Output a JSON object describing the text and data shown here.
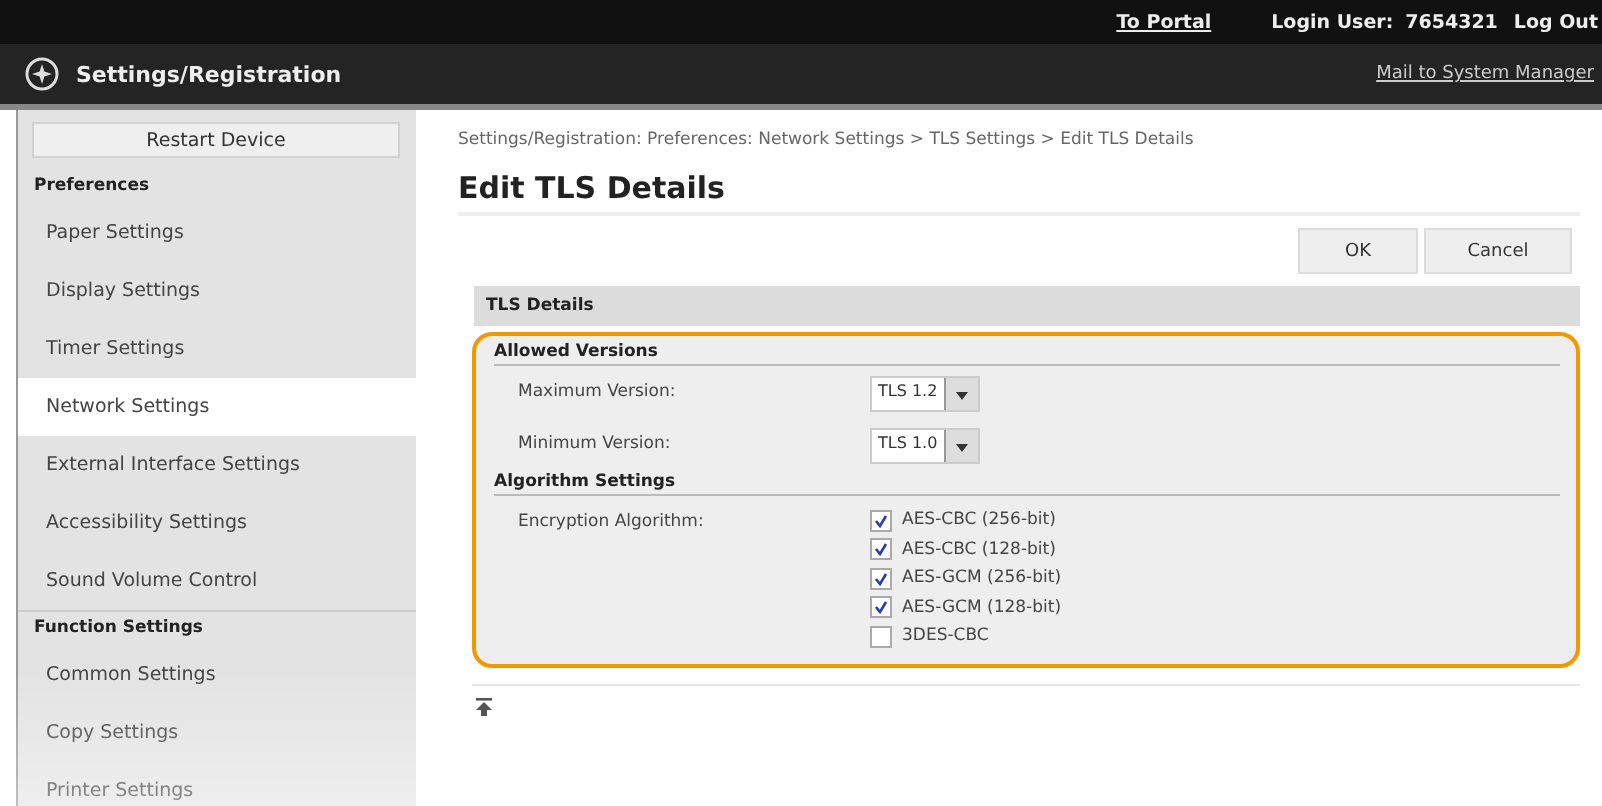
{
  "top_bar": {
    "portal_link": "To Portal",
    "login_label": "Login User:",
    "login_user": "7654321",
    "logout_link": "Log Out"
  },
  "header": {
    "title": "Settings/Registration",
    "mail_link": "Mail to System Manager"
  },
  "sidebar": {
    "restart_button": "Restart Device",
    "sections": [
      {
        "heading": "Preferences",
        "items": [
          {
            "label": "Paper Settings",
            "selected": false
          },
          {
            "label": "Display Settings",
            "selected": false
          },
          {
            "label": "Timer Settings",
            "selected": false
          },
          {
            "label": "Network Settings",
            "selected": true
          },
          {
            "label": "External Interface Settings",
            "selected": false
          },
          {
            "label": "Accessibility Settings",
            "selected": false
          },
          {
            "label": "Sound Volume Control",
            "selected": false
          }
        ]
      },
      {
        "heading": "Function Settings",
        "items": [
          {
            "label": "Common Settings",
            "selected": false
          },
          {
            "label": "Copy Settings",
            "selected": false
          },
          {
            "label": "Printer Settings",
            "selected": false
          }
        ]
      }
    ]
  },
  "main": {
    "breadcrumb": "Settings/Registration: Preferences: Network Settings > TLS Settings > Edit TLS Details",
    "title": "Edit TLS Details",
    "buttons": [
      "OK",
      "Cancel"
    ],
    "panel": {
      "title": "TLS Details",
      "groups": [
        {
          "heading": "Allowed Versions",
          "rows": [
            {
              "kind": "select",
              "label": "Maximum Version:",
              "value": "TLS 1.2"
            },
            {
              "kind": "select",
              "label": "Minimum Version:",
              "value": "TLS 1.0"
            }
          ]
        },
        {
          "heading": "Algorithm Settings",
          "rows": [
            {
              "kind": "checkboxes",
              "label": "Encryption Algorithm:",
              "options": [
                {
                  "label": "AES-CBC (256-bit)",
                  "checked": true
                },
                {
                  "label": "AES-CBC (128-bit)",
                  "checked": true
                },
                {
                  "label": "AES-GCM (256-bit)",
                  "checked": true
                },
                {
                  "label": "AES-GCM (128-bit)",
                  "checked": true
                },
                {
                  "label": "3DES-CBC",
                  "checked": false
                }
              ]
            }
          ]
        }
      ]
    }
  }
}
